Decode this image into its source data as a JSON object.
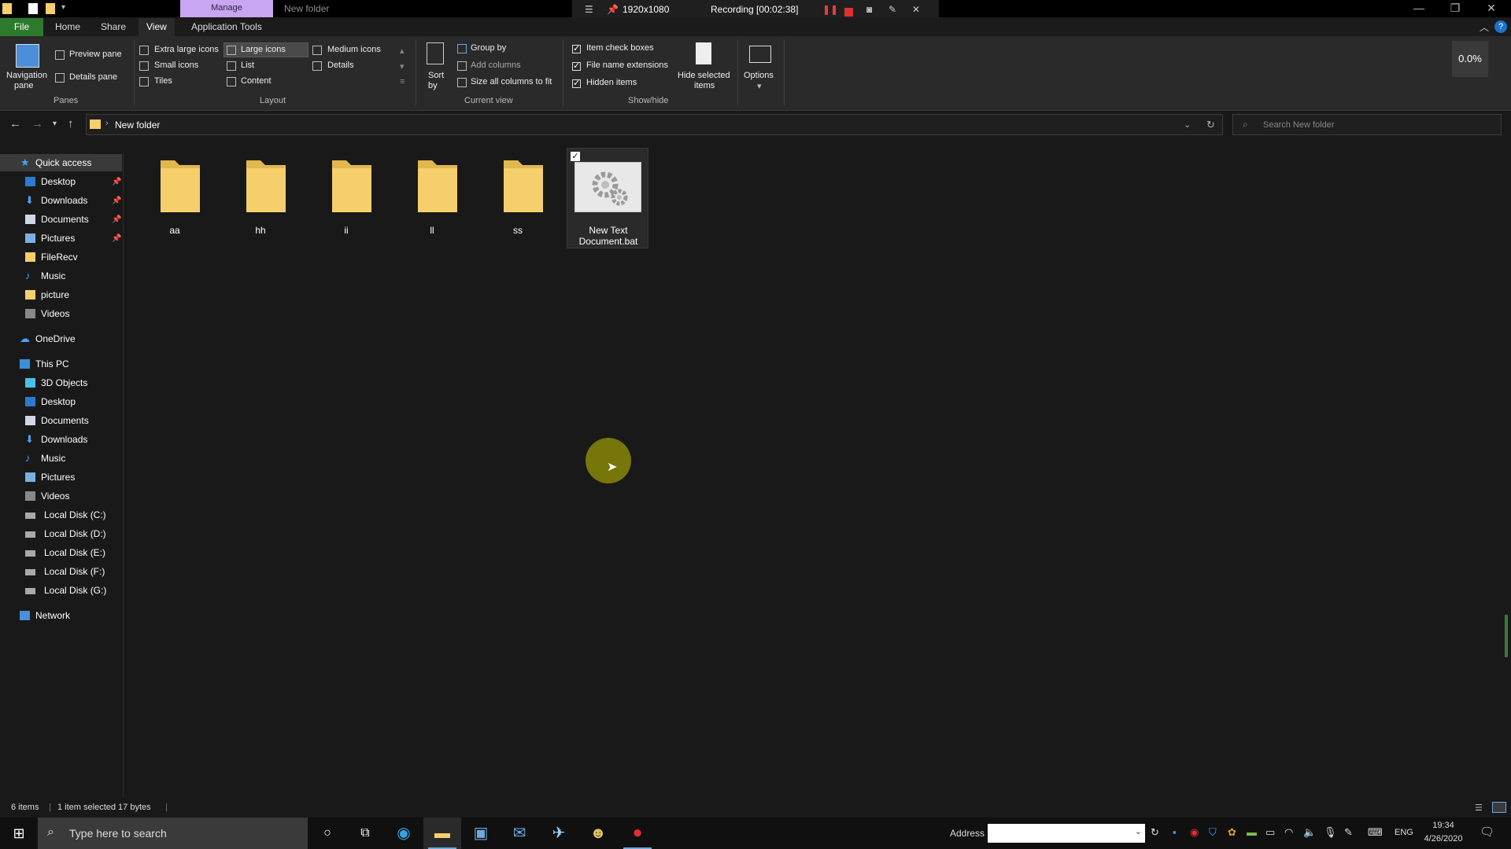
{
  "titlebar": {
    "manage_tab": "Manage",
    "window_title": "New folder",
    "recorder": {
      "resolution": "1920x1080",
      "status": "Recording [00:02:38]"
    }
  },
  "ribbon_tabs": [
    "File",
    "Home",
    "Share",
    "View",
    "Application Tools"
  ],
  "ribbon": {
    "panes": {
      "navigation_pane": "Navigation",
      "navigation_pane_2": "pane",
      "preview_pane": "Preview pane",
      "details_pane": "Details pane",
      "group_label": "Panes"
    },
    "layout": {
      "options": [
        "Extra large icons",
        "Large icons",
        "Medium icons",
        "Small icons",
        "List",
        "Details",
        "Tiles",
        "Content"
      ],
      "selected": "Large icons",
      "group_label": "Layout"
    },
    "current_view": {
      "sort_by": "Sort",
      "sort_by_2": "by",
      "group_by": "Group by",
      "add_columns": "Add columns",
      "size_all": "Size all columns to fit",
      "group_label": "Current view"
    },
    "show_hide": {
      "item_check_boxes": "Item check boxes",
      "file_name_extensions": "File name extensions",
      "hidden_items": "Hidden items",
      "hide_selected": "Hide selected",
      "hide_selected_2": "items",
      "group_label": "Show/hide"
    },
    "options": "Options",
    "percent": "0.0%"
  },
  "address": {
    "path": "New folder",
    "search_placeholder": "Search New folder"
  },
  "sidebar": {
    "quick_access": "Quick access",
    "quick_items": [
      "Desktop",
      "Downloads",
      "Documents",
      "Pictures",
      "FileRecv",
      "Music",
      "picture",
      "Videos"
    ],
    "onedrive": "OneDrive",
    "this_pc": "This PC",
    "pc_items": [
      "3D Objects",
      "Desktop",
      "Documents",
      "Downloads",
      "Music",
      "Pictures",
      "Videos",
      "Local Disk (C:)",
      "Local Disk (D:)",
      "Local Disk (E:)",
      "Local Disk (F:)",
      "Local Disk (G:)"
    ],
    "network": "Network"
  },
  "content": {
    "folders": [
      "aa",
      "hh",
      "ii",
      "ll",
      "ss"
    ],
    "file_line1": "New Text",
    "file_line2": "Document.bat"
  },
  "status": {
    "items": "6 items",
    "selected": "1 item selected  17 bytes"
  },
  "taskbar": {
    "search_placeholder": "Type here to search",
    "address_label": "Address",
    "language": "ENG",
    "time": "19:34",
    "date": "4/26/2020"
  },
  "colors": {
    "file_tab": "#2c7a2c",
    "manage_tab": "#c8a6f0",
    "folder": "#f5cf6b",
    "halo": "#b4b400"
  }
}
